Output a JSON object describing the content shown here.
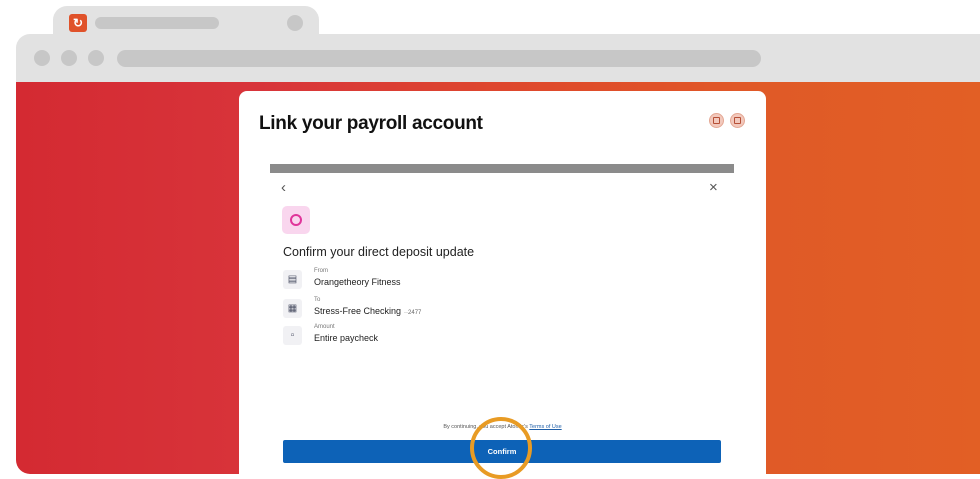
{
  "modal": {
    "title": "Link your payroll account",
    "nav": {
      "back_icon": "‹",
      "close_icon": "×"
    },
    "heading": "Confirm your direct deposit update",
    "rows": [
      {
        "icon": "building-icon",
        "label": "From",
        "value": "Orangetheory Fitness",
        "suffix": ""
      },
      {
        "icon": "bank-icon",
        "label": "To",
        "value": "Stress-Free Checking",
        "suffix": "··2477"
      },
      {
        "icon": "money-icon",
        "label": "Amount",
        "value": "Entire paycheck",
        "suffix": ""
      }
    ],
    "terms": {
      "prefix": "By continuing, you accept Atomic's",
      "link": "Terms of Use"
    },
    "confirm_label": "Confirm"
  },
  "colors": {
    "viewport_left": "#d42a32",
    "viewport_right": "#e25f25",
    "primary_button": "#0d62b7",
    "highlight_ring": "#e89b24",
    "app_logo_bg": "#f9d6ee",
    "app_logo_ring": "#e0359a"
  }
}
